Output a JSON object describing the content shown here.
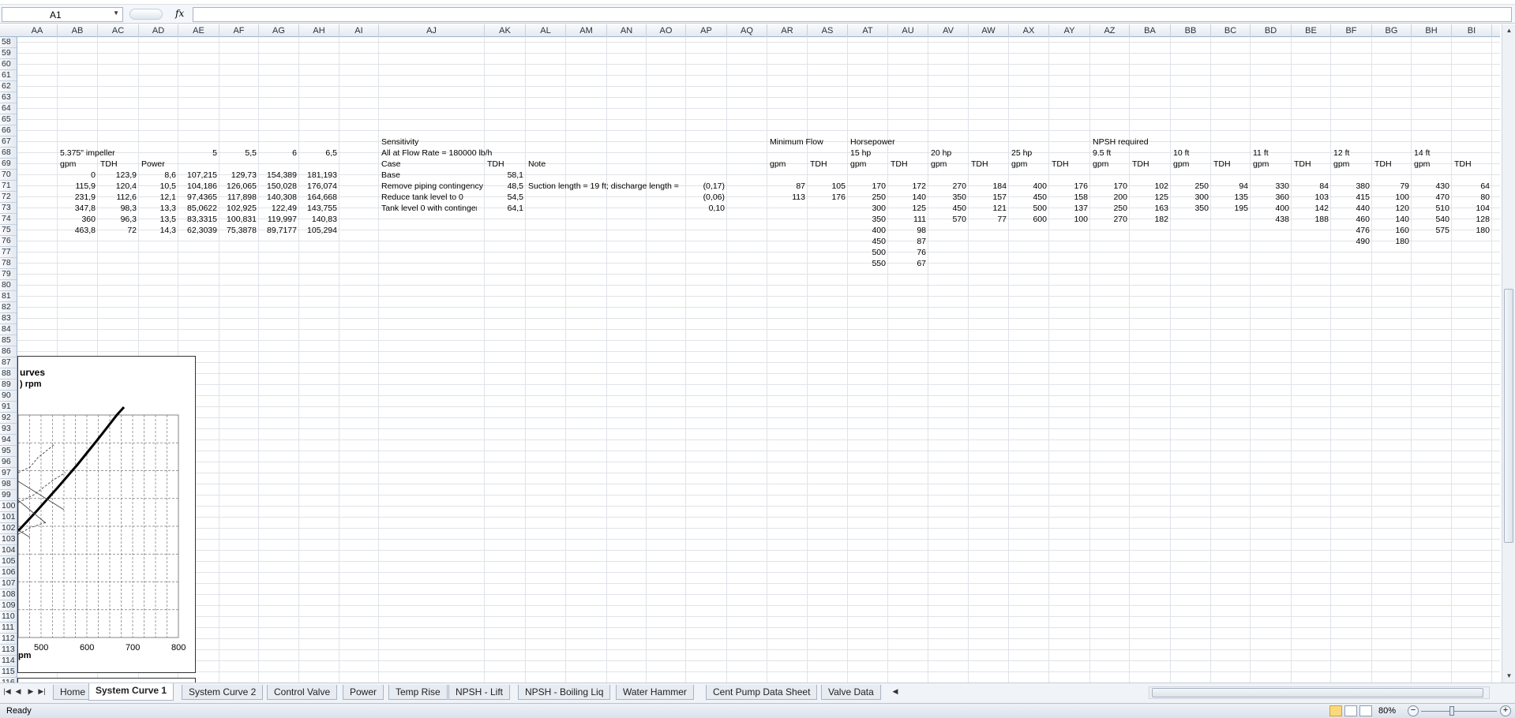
{
  "formula_bar": {
    "name_box": "A1",
    "fx_label": "fx",
    "formula": ""
  },
  "columns": [
    "AA",
    "AB",
    "AC",
    "AD",
    "AE",
    "AF",
    "AG",
    "AH",
    "AI",
    "AJ",
    "AK",
    "AL",
    "AM",
    "AN",
    "AO",
    "AP",
    "AQ",
    "AR",
    "AS",
    "AT",
    "AU",
    "AV",
    "AW",
    "AX",
    "AY",
    "AZ",
    "BA",
    "BB",
    "BC",
    "BD",
    "BE",
    "BF",
    "BG",
    "BH",
    "BI"
  ],
  "rows": [
    "58",
    "59",
    "60",
    "61",
    "62",
    "63",
    "64",
    "65",
    "66",
    "67",
    "68",
    "69",
    "70",
    "71",
    "72",
    "73",
    "74",
    "75",
    "76",
    "77",
    "78",
    "79",
    "80",
    "81",
    "82",
    "83",
    "84",
    "85",
    "86",
    "87",
    "88",
    "89",
    "90",
    "91",
    "92",
    "93",
    "94",
    "95",
    "96",
    "97",
    "98",
    "99",
    "100",
    "101",
    "102",
    "103",
    "104",
    "105",
    "106",
    "107",
    "108",
    "109",
    "110",
    "111",
    "112",
    "113",
    "114",
    "115",
    "116"
  ],
  "cells": [
    [
      "AB",
      "68",
      "5.375\" impeller",
      "t"
    ],
    [
      "AE",
      "68",
      "5",
      "n"
    ],
    [
      "AF",
      "68",
      "5,5",
      "n"
    ],
    [
      "AG",
      "68",
      "6",
      "n"
    ],
    [
      "AH",
      "68",
      "6,5",
      "n"
    ],
    [
      "AB",
      "69",
      "gpm",
      "t"
    ],
    [
      "AC",
      "69",
      "TDH",
      "t"
    ],
    [
      "AD",
      "69",
      "Power",
      "t"
    ],
    [
      "AB",
      "70",
      "0",
      "n"
    ],
    [
      "AC",
      "70",
      "123,9",
      "n"
    ],
    [
      "AD",
      "70",
      "8,6",
      "n"
    ],
    [
      "AE",
      "70",
      "107,215",
      "n"
    ],
    [
      "AF",
      "70",
      "129,73",
      "n"
    ],
    [
      "AG",
      "70",
      "154,389",
      "n"
    ],
    [
      "AH",
      "70",
      "181,193",
      "n"
    ],
    [
      "AB",
      "71",
      "115,9",
      "n"
    ],
    [
      "AC",
      "71",
      "120,4",
      "n"
    ],
    [
      "AD",
      "71",
      "10,5",
      "n"
    ],
    [
      "AE",
      "71",
      "104,186",
      "n"
    ],
    [
      "AF",
      "71",
      "126,065",
      "n"
    ],
    [
      "AG",
      "71",
      "150,028",
      "n"
    ],
    [
      "AH",
      "71",
      "176,074",
      "n"
    ],
    [
      "AB",
      "72",
      "231,9",
      "n"
    ],
    [
      "AC",
      "72",
      "112,6",
      "n"
    ],
    [
      "AD",
      "72",
      "12,1",
      "n"
    ],
    [
      "AE",
      "72",
      "97,4365",
      "n"
    ],
    [
      "AF",
      "72",
      "117,898",
      "n"
    ],
    [
      "AG",
      "72",
      "140,308",
      "n"
    ],
    [
      "AH",
      "72",
      "164,668",
      "n"
    ],
    [
      "AB",
      "73",
      "347,8",
      "n"
    ],
    [
      "AC",
      "73",
      "98,3",
      "n"
    ],
    [
      "AD",
      "73",
      "13,3",
      "n"
    ],
    [
      "AE",
      "73",
      "85,0622",
      "n"
    ],
    [
      "AF",
      "73",
      "102,925",
      "n"
    ],
    [
      "AG",
      "73",
      "122,49",
      "n"
    ],
    [
      "AH",
      "73",
      "143,755",
      "n"
    ],
    [
      "AB",
      "74",
      "360",
      "n"
    ],
    [
      "AC",
      "74",
      "96,3",
      "n"
    ],
    [
      "AD",
      "74",
      "13,5",
      "n"
    ],
    [
      "AE",
      "74",
      "83,3315",
      "n"
    ],
    [
      "AF",
      "74",
      "100,831",
      "n"
    ],
    [
      "AG",
      "74",
      "119,997",
      "n"
    ],
    [
      "AH",
      "74",
      "140,83",
      "n"
    ],
    [
      "AB",
      "75",
      "463,8",
      "n"
    ],
    [
      "AC",
      "75",
      "72",
      "n"
    ],
    [
      "AD",
      "75",
      "14,3",
      "n"
    ],
    [
      "AE",
      "75",
      "62,3039",
      "n"
    ],
    [
      "AF",
      "75",
      "75,3878",
      "n"
    ],
    [
      "AG",
      "75",
      "89,7177",
      "n"
    ],
    [
      "AH",
      "75",
      "105,294",
      "n"
    ],
    [
      "AJ",
      "67",
      "Sensitivity",
      "t"
    ],
    [
      "AJ",
      "68",
      "All at Flow Rate = 180000 lb/h",
      "t"
    ],
    [
      "AJ",
      "69",
      "Case",
      "t"
    ],
    [
      "AK",
      "69",
      "TDH",
      "t"
    ],
    [
      "AL",
      "69",
      "Note",
      "t"
    ],
    [
      "AJ",
      "70",
      "Base",
      "t"
    ],
    [
      "AK",
      "70",
      "58,1",
      "n"
    ],
    [
      "AJ",
      "71",
      "Remove piping contingency",
      "t"
    ],
    [
      "AK",
      "71",
      "48,5",
      "n"
    ],
    [
      "AL",
      "71",
      "Suction length = 19 ft; discharge length =",
      "t"
    ],
    [
      "AP",
      "71",
      "(0,17)",
      "n"
    ],
    [
      "AJ",
      "72",
      "Reduce tank level to 0",
      "t"
    ],
    [
      "AK",
      "72",
      "54,5",
      "n"
    ],
    [
      "AP",
      "72",
      "(0,06)",
      "n"
    ],
    [
      "AJ",
      "73",
      "Tank level 0 with contingen",
      "t"
    ],
    [
      "AK",
      "73",
      "64,1",
      "n"
    ],
    [
      "AP",
      "73",
      "0,10",
      "n"
    ],
    [
      "AR",
      "67",
      "Minimum Flow",
      "t"
    ],
    [
      "AT",
      "67",
      "Horsepower",
      "t"
    ],
    [
      "AZ",
      "67",
      "NPSH required",
      "t"
    ],
    [
      "AT",
      "68",
      "15 hp",
      "t"
    ],
    [
      "AV",
      "68",
      "20 hp",
      "t"
    ],
    [
      "AX",
      "68",
      "25 hp",
      "t"
    ],
    [
      "AZ",
      "68",
      "9.5 ft",
      "t"
    ],
    [
      "BB",
      "68",
      "10 ft",
      "t"
    ],
    [
      "BD",
      "68",
      "11 ft",
      "t"
    ],
    [
      "BF",
      "68",
      "12 ft",
      "t"
    ],
    [
      "BH",
      "68",
      "14 ft",
      "t"
    ],
    [
      "AR",
      "69",
      "gpm",
      "t"
    ],
    [
      "AS",
      "69",
      "TDH",
      "t"
    ],
    [
      "AT",
      "69",
      "gpm",
      "t"
    ],
    [
      "AU",
      "69",
      "TDH",
      "t"
    ],
    [
      "AV",
      "69",
      "gpm",
      "t"
    ],
    [
      "AW",
      "69",
      "TDH",
      "t"
    ],
    [
      "AX",
      "69",
      "gpm",
      "t"
    ],
    [
      "AY",
      "69",
      "TDH",
      "t"
    ],
    [
      "AZ",
      "69",
      "gpm",
      "t"
    ],
    [
      "BA",
      "69",
      "TDH",
      "t"
    ],
    [
      "BB",
      "69",
      "gpm",
      "t"
    ],
    [
      "BC",
      "69",
      "TDH",
      "t"
    ],
    [
      "BD",
      "69",
      "gpm",
      "t"
    ],
    [
      "BE",
      "69",
      "TDH",
      "t"
    ],
    [
      "BF",
      "69",
      "gpm",
      "t"
    ],
    [
      "BG",
      "69",
      "TDH",
      "t"
    ],
    [
      "BH",
      "69",
      "gpm",
      "t"
    ],
    [
      "BI",
      "69",
      "TDH",
      "t"
    ],
    [
      "AR",
      "71",
      "87",
      "n"
    ],
    [
      "AS",
      "71",
      "105",
      "n"
    ],
    [
      "AT",
      "71",
      "170",
      "n"
    ],
    [
      "AU",
      "71",
      "172",
      "n"
    ],
    [
      "AV",
      "71",
      "270",
      "n"
    ],
    [
      "AW",
      "71",
      "184",
      "n"
    ],
    [
      "AX",
      "71",
      "400",
      "n"
    ],
    [
      "AY",
      "71",
      "176",
      "n"
    ],
    [
      "AZ",
      "71",
      "170",
      "n"
    ],
    [
      "BA",
      "71",
      "102",
      "n"
    ],
    [
      "BB",
      "71",
      "250",
      "n"
    ],
    [
      "BC",
      "71",
      "94",
      "n"
    ],
    [
      "BD",
      "71",
      "330",
      "n"
    ],
    [
      "BE",
      "71",
      "84",
      "n"
    ],
    [
      "BF",
      "71",
      "380",
      "n"
    ],
    [
      "BG",
      "71",
      "79",
      "n"
    ],
    [
      "BH",
      "71",
      "430",
      "n"
    ],
    [
      "BI",
      "71",
      "64",
      "n"
    ],
    [
      "AR",
      "72",
      "113",
      "n"
    ],
    [
      "AS",
      "72",
      "176",
      "n"
    ],
    [
      "AT",
      "72",
      "250",
      "n"
    ],
    [
      "AU",
      "72",
      "140",
      "n"
    ],
    [
      "AV",
      "72",
      "350",
      "n"
    ],
    [
      "AW",
      "72",
      "157",
      "n"
    ],
    [
      "AX",
      "72",
      "450",
      "n"
    ],
    [
      "AY",
      "72",
      "158",
      "n"
    ],
    [
      "AZ",
      "72",
      "200",
      "n"
    ],
    [
      "BA",
      "72",
      "125",
      "n"
    ],
    [
      "BB",
      "72",
      "300",
      "n"
    ],
    [
      "BC",
      "72",
      "135",
      "n"
    ],
    [
      "BD",
      "72",
      "360",
      "n"
    ],
    [
      "BE",
      "72",
      "103",
      "n"
    ],
    [
      "BF",
      "72",
      "415",
      "n"
    ],
    [
      "BG",
      "72",
      "100",
      "n"
    ],
    [
      "BH",
      "72",
      "470",
      "n"
    ],
    [
      "BI",
      "72",
      "80",
      "n"
    ],
    [
      "AT",
      "73",
      "300",
      "n"
    ],
    [
      "AU",
      "73",
      "125",
      "n"
    ],
    [
      "AV",
      "73",
      "450",
      "n"
    ],
    [
      "AW",
      "73",
      "121",
      "n"
    ],
    [
      "AX",
      "73",
      "500",
      "n"
    ],
    [
      "AY",
      "73",
      "137",
      "n"
    ],
    [
      "AZ",
      "73",
      "250",
      "n"
    ],
    [
      "BA",
      "73",
      "163",
      "n"
    ],
    [
      "BB",
      "73",
      "350",
      "n"
    ],
    [
      "BC",
      "73",
      "195",
      "n"
    ],
    [
      "BD",
      "73",
      "400",
      "n"
    ],
    [
      "BE",
      "73",
      "142",
      "n"
    ],
    [
      "BF",
      "73",
      "440",
      "n"
    ],
    [
      "BG",
      "73",
      "120",
      "n"
    ],
    [
      "BH",
      "73",
      "510",
      "n"
    ],
    [
      "BI",
      "73",
      "104",
      "n"
    ],
    [
      "AT",
      "74",
      "350",
      "n"
    ],
    [
      "AU",
      "74",
      "111",
      "n"
    ],
    [
      "AV",
      "74",
      "570",
      "n"
    ],
    [
      "AW",
      "74",
      "77",
      "n"
    ],
    [
      "AX",
      "74",
      "600",
      "n"
    ],
    [
      "AY",
      "74",
      "100",
      "n"
    ],
    [
      "AZ",
      "74",
      "270",
      "n"
    ],
    [
      "BA",
      "74",
      "182",
      "n"
    ],
    [
      "BD",
      "74",
      "438",
      "n"
    ],
    [
      "BE",
      "74",
      "188",
      "n"
    ],
    [
      "BF",
      "74",
      "460",
      "n"
    ],
    [
      "BG",
      "74",
      "140",
      "n"
    ],
    [
      "BH",
      "74",
      "540",
      "n"
    ],
    [
      "BI",
      "74",
      "128",
      "n"
    ],
    [
      "AT",
      "75",
      "400",
      "n"
    ],
    [
      "AU",
      "75",
      "98",
      "n"
    ],
    [
      "BF",
      "75",
      "476",
      "n"
    ],
    [
      "BG",
      "75",
      "160",
      "n"
    ],
    [
      "BH",
      "75",
      "575",
      "n"
    ],
    [
      "BI",
      "75",
      "180",
      "n"
    ],
    [
      "AT",
      "76",
      "450",
      "n"
    ],
    [
      "AU",
      "76",
      "87",
      "n"
    ],
    [
      "BF",
      "76",
      "490",
      "n"
    ],
    [
      "BG",
      "76",
      "180",
      "n"
    ],
    [
      "AT",
      "77",
      "500",
      "n"
    ],
    [
      "AU",
      "77",
      "76",
      "n"
    ],
    [
      "AT",
      "78",
      "550",
      "n"
    ],
    [
      "AU",
      "78",
      "67",
      "n"
    ]
  ],
  "chart": {
    "title_fragment": "urves",
    "subtitle_fragment": ") rpm",
    "x_ticks": [
      "500",
      "600",
      "700",
      "800"
    ],
    "x_label_fragment": "pm"
  },
  "sheet_tabs": [
    "Home",
    "System Curve 1",
    "System Curve 2",
    "Control Valve",
    "Power",
    "Temp Rise",
    "NPSH - Lift",
    "NPSH - Boiling Liq",
    "Water Hammer",
    "Cent Pump Data Sheet",
    "Valve Data"
  ],
  "active_tab": "System Curve 1",
  "status": {
    "text": "Ready",
    "zoom": "80%"
  }
}
